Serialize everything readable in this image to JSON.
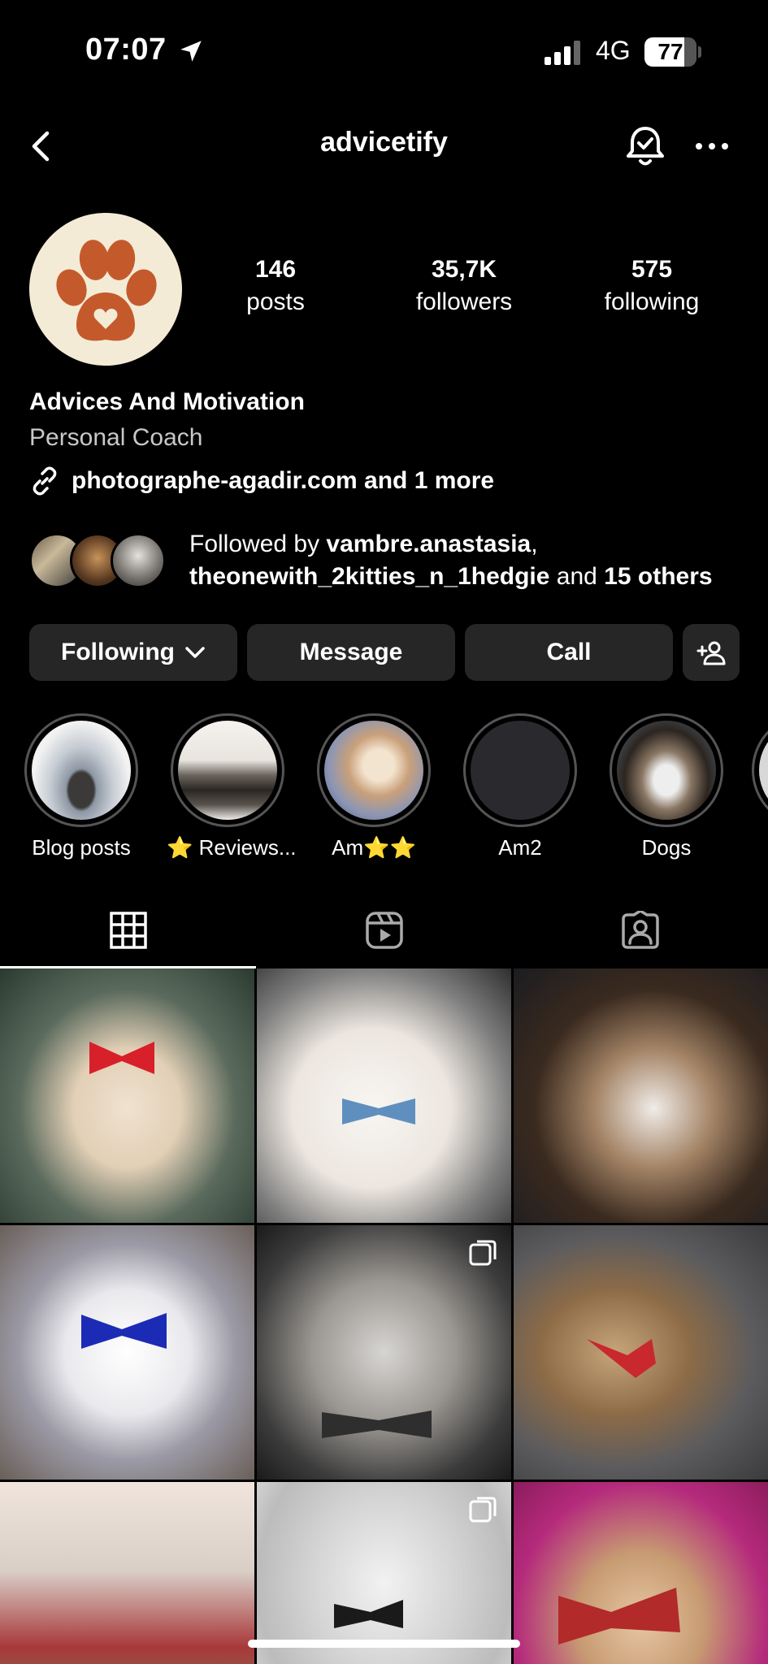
{
  "status": {
    "time": "07:07",
    "network": "4G",
    "battery_text": "77",
    "battery_level": 0.77
  },
  "header": {
    "title": "advicetify",
    "back_icon": "chevron-left-icon",
    "notifications_icon": "bell-check-icon",
    "more_icon": "more-horizontal-icon"
  },
  "profile": {
    "avatar_icon": "paw-heart-icon",
    "stats": [
      {
        "number": "146",
        "label": "posts"
      },
      {
        "number": "35,7K",
        "label": "followers"
      },
      {
        "number": "575",
        "label": "following"
      }
    ],
    "name": "Advices And Motivation",
    "category": "Personal Coach",
    "link": "photographe-agadir.com and 1 more",
    "followed_by": {
      "prefix": "Followed by ",
      "user1": "vambre.anastasia",
      "sep": ",",
      "user2": "theonewith_2kitties_n_1hedgie",
      "mid": " and ",
      "others": "15 others"
    }
  },
  "actions": {
    "following": "Following",
    "message": "Message",
    "call": "Call",
    "add_person_icon": "add-person-icon"
  },
  "highlights": [
    {
      "label": "Blog posts"
    },
    {
      "label": "⭐ Reviews..."
    },
    {
      "label": "Am⭐⭐"
    },
    {
      "label": "Am2"
    },
    {
      "label": "Dogs"
    }
  ],
  "tabs": [
    {
      "icon": "grid-icon",
      "active": true
    },
    {
      "icon": "reels-icon",
      "active": false
    },
    {
      "icon": "tagged-icon",
      "active": false
    }
  ],
  "colors": {
    "background": "#000000",
    "button": "#262626",
    "paw": "#c45a2c",
    "avatar_bg": "#f4ebd6"
  }
}
